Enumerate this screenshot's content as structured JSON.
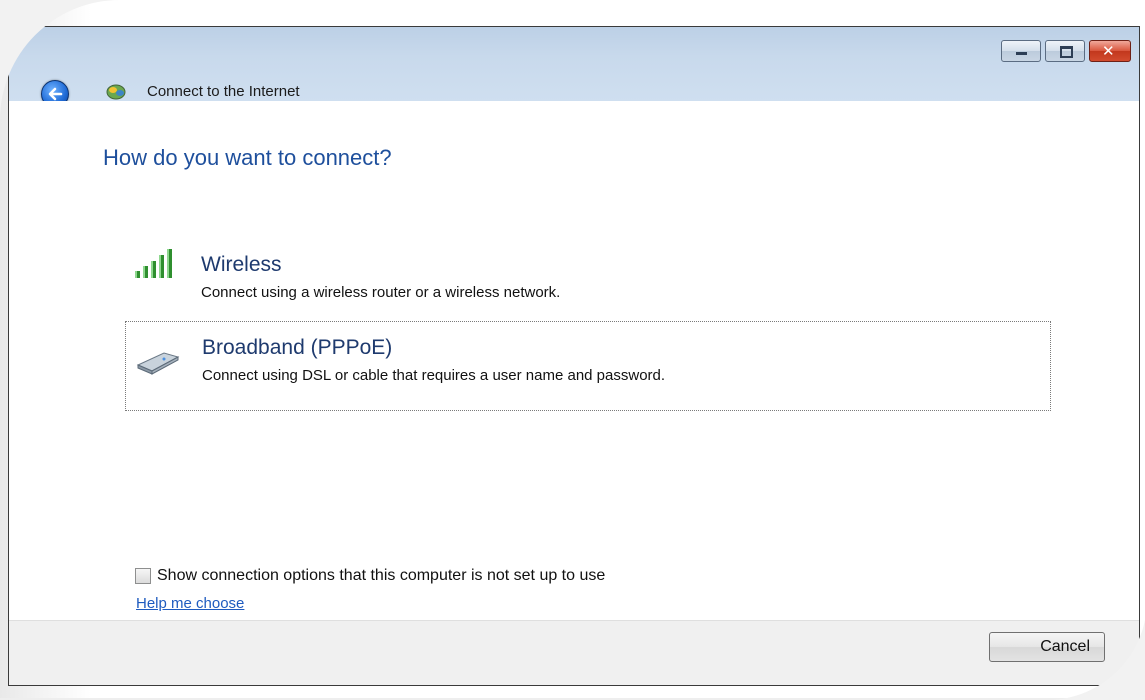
{
  "window": {
    "title": "Connect to the Internet",
    "controls": {
      "minimize": "minimize",
      "maximize": "maximize",
      "close": "close"
    }
  },
  "main": {
    "heading": "How do you want to connect?",
    "options": [
      {
        "icon": "signal-bars-icon",
        "title": "Wireless",
        "description": "Connect using a wireless router or a wireless network."
      },
      {
        "icon": "modem-icon",
        "title": "Broadband (PPPoE)",
        "description": "Connect using DSL or cable that requires a user name and password."
      }
    ],
    "show_options_label": "Show connection options that this computer is not set up to use",
    "show_options_checked": false,
    "help_link": "Help me choose"
  },
  "footer": {
    "cancel_label": "Cancel"
  },
  "colors": {
    "heading": "#1e4f9c",
    "link": "#1e5bbf",
    "titlebar": "#bcd0e6"
  }
}
